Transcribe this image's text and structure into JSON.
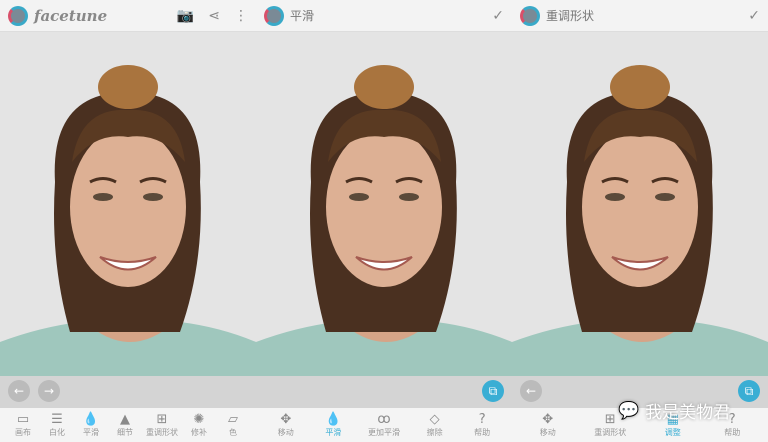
{
  "panel1": {
    "brand": "facetune",
    "icons": [
      "camera-icon",
      "share-icon",
      "more-icon"
    ],
    "tools": [
      {
        "label": "画布",
        "icon": "▭"
      },
      {
        "label": "白化",
        "icon": "☰"
      },
      {
        "label": "平滑",
        "icon": "💧"
      },
      {
        "label": "细节",
        "icon": "▲"
      },
      {
        "label": "重调形状",
        "icon": "⊞"
      },
      {
        "label": "修补",
        "icon": "✺"
      },
      {
        "label": "色",
        "icon": "▱"
      }
    ]
  },
  "panel2": {
    "title": "平滑",
    "confirm": "✓",
    "tools": [
      {
        "label": "移动",
        "icon": "✥"
      },
      {
        "label": "平滑",
        "icon": "💧",
        "active": true
      },
      {
        "label": "更加平滑",
        "icon": "ꝏ"
      },
      {
        "label": "擦除",
        "icon": "◇"
      },
      {
        "label": "帮助",
        "icon": "?"
      }
    ]
  },
  "panel3": {
    "title": "重调形状",
    "confirm": "✓",
    "tools": [
      {
        "label": "移动",
        "icon": "✥"
      },
      {
        "label": "重调形状",
        "icon": "⊞"
      },
      {
        "label": "调整",
        "icon": "▦",
        "active": true
      },
      {
        "label": "帮助",
        "icon": "?"
      }
    ]
  },
  "watermark": "我是美物君",
  "accent": "#3aaed4"
}
